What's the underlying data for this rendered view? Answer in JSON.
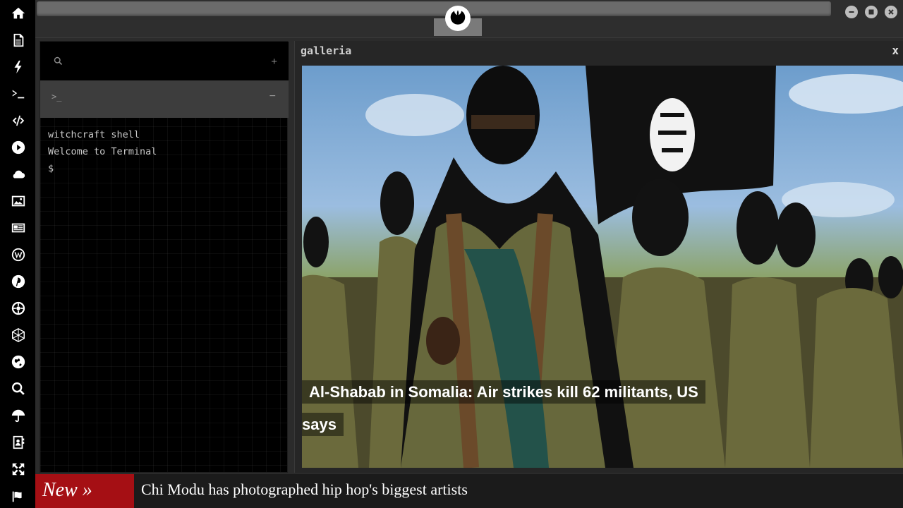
{
  "sidebar": {
    "icons": [
      {
        "name": "home-icon"
      },
      {
        "name": "document-icon"
      },
      {
        "name": "bolt-icon"
      },
      {
        "name": "terminal-icon"
      },
      {
        "name": "code-icon"
      },
      {
        "name": "play-icon"
      },
      {
        "name": "cloud-icon"
      },
      {
        "name": "image-icon"
      },
      {
        "name": "newspaper-icon"
      },
      {
        "name": "wordpress-icon"
      },
      {
        "name": "pinterest-icon"
      },
      {
        "name": "galactic-empire-icon"
      },
      {
        "name": "geometry-icon"
      },
      {
        "name": "globe-icon"
      },
      {
        "name": "search-icon"
      },
      {
        "name": "umbrella-icon"
      },
      {
        "name": "contact-book-icon"
      },
      {
        "name": "expand-icon"
      },
      {
        "name": "flag-icon"
      }
    ]
  },
  "topbar": {
    "logo": "rebel-alliance-logo",
    "window_controls": [
      "minimize",
      "maximize",
      "close"
    ]
  },
  "terminal": {
    "search_icon": "search-icon",
    "add_label": "+",
    "tab_prompt": ">_",
    "tab_minimize": "−",
    "lines": [
      "witchcraft shell",
      "Welcome to Terminal",
      "$"
    ]
  },
  "gallery": {
    "title": "galleria",
    "close_label": "x",
    "headline_line1": "Al-Shabab in Somalia: Air strikes kill 62 militants, US",
    "headline_line2": "says"
  },
  "ticker": {
    "badge": "New »",
    "text": "Chi Modu has photographed hip hop's biggest artists"
  },
  "colors": {
    "ticker_badge": "#a50f14",
    "sidebar_bg": "#000000",
    "panel_bg": "#262626"
  }
}
